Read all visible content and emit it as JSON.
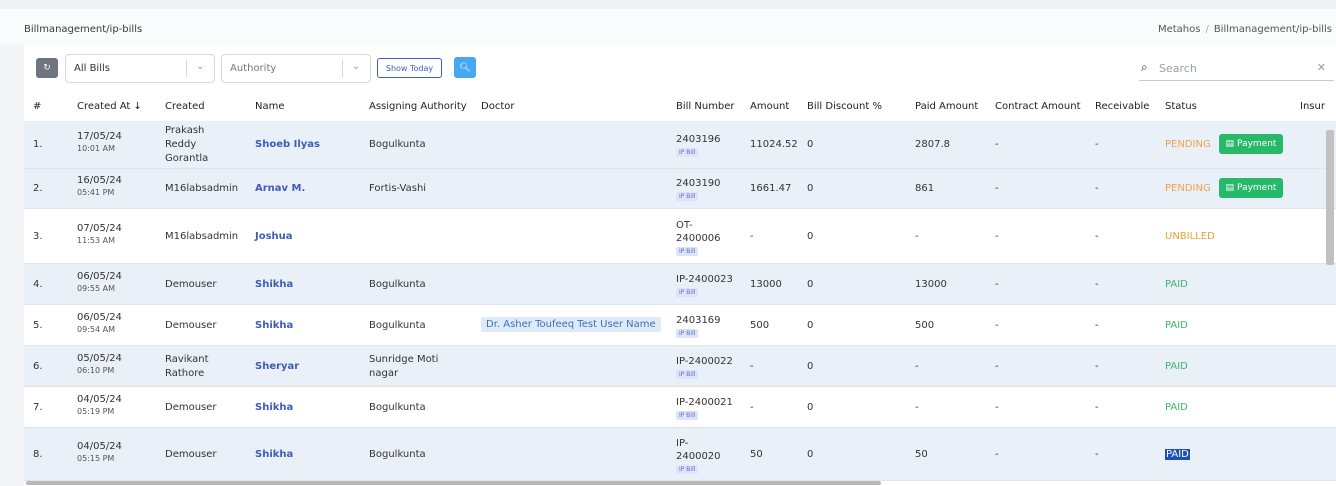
{
  "page_title": "Billmanagement/ip-bills",
  "breadcrumb": [
    "Metahos",
    "Billmanagement/ip-bills"
  ],
  "toolbar": {
    "refresh_icon": "refresh-icon",
    "bills_filter": "All Bills",
    "authority_placeholder": "Authority",
    "show_today": "Show Today",
    "search_button_icon": "search-icon",
    "search_placeholder": "Search"
  },
  "columns": [
    "#",
    "Created At",
    "Created",
    "Name",
    "Assigning Authority",
    "Doctor",
    "Bill Number",
    "Amount",
    "Bill Discount %",
    "Paid Amount",
    "Contract Amount",
    "Receivable",
    "Status",
    "Insur"
  ],
  "bill_badge": "IP Bill",
  "payment_label": "Payment",
  "rows": [
    {
      "num": "1.",
      "date": "17/05/24",
      "time": "10:01 AM",
      "created": [
        "Prakash",
        "Reddy",
        "Gorantla"
      ],
      "name": "Shoeb Ilyas",
      "authority": [
        "Bogulkunta"
      ],
      "doctor": "",
      "bill": [
        "2403196"
      ],
      "amount": "11024.52",
      "discount": "0",
      "paid": "2807.8",
      "contract": "-",
      "receivable": "-",
      "status": "PENDING"
    },
    {
      "num": "2.",
      "date": "16/05/24",
      "time": "05:41 PM",
      "created": [
        "M16labsadmin"
      ],
      "name": "Arnav M.",
      "authority": [
        "Fortis-Vashi"
      ],
      "doctor": "",
      "bill": [
        "2403190"
      ],
      "amount": "1661.47",
      "discount": "0",
      "paid": "861",
      "contract": "-",
      "receivable": "-",
      "status": "PENDING"
    },
    {
      "num": "3.",
      "date": "07/05/24",
      "time": "11:53 AM",
      "created": [
        "M16labsadmin"
      ],
      "name": "Joshua",
      "authority": [],
      "doctor": "",
      "bill": [
        "OT-",
        "2400006"
      ],
      "amount": "-",
      "discount": "0",
      "paid": "-",
      "contract": "-",
      "receivable": "-",
      "status": "UNBILLED"
    },
    {
      "num": "4.",
      "date": "06/05/24",
      "time": "09:55 AM",
      "created": [
        "Demouser"
      ],
      "name": "Shikha",
      "authority": [
        "Bogulkunta"
      ],
      "doctor": "",
      "bill": [
        "IP-2400023"
      ],
      "amount": "13000",
      "discount": "0",
      "paid": "13000",
      "contract": "-",
      "receivable": "-",
      "status": "PAID"
    },
    {
      "num": "5.",
      "date": "06/05/24",
      "time": "09:54 AM",
      "created": [
        "Demouser"
      ],
      "name": "Shikha",
      "authority": [
        "Bogulkunta"
      ],
      "doctor": "Dr. Asher Toufeeq Test User Name",
      "bill": [
        "2403169"
      ],
      "amount": "500",
      "discount": "0",
      "paid": "500",
      "contract": "-",
      "receivable": "-",
      "status": "PAID"
    },
    {
      "num": "6.",
      "date": "05/05/24",
      "time": "06:10 PM",
      "created": [
        "Ravikant",
        "Rathore"
      ],
      "name": "Sheryar",
      "authority": [
        "Sunridge Moti",
        "nagar"
      ],
      "doctor": "",
      "bill": [
        "IP-2400022"
      ],
      "amount": "-",
      "discount": "0",
      "paid": "-",
      "contract": "-",
      "receivable": "-",
      "status": "PAID"
    },
    {
      "num": "7.",
      "date": "04/05/24",
      "time": "05:19 PM",
      "created": [
        "Demouser"
      ],
      "name": "Shikha",
      "authority": [
        "Bogulkunta"
      ],
      "doctor": "",
      "bill": [
        "IP-2400021"
      ],
      "amount": "-",
      "discount": "0",
      "paid": "-",
      "contract": "-",
      "receivable": "-",
      "status": "PAID"
    },
    {
      "num": "8.",
      "date": "04/05/24",
      "time": "05:15 PM",
      "created": [
        "Demouser"
      ],
      "name": "Shikha",
      "authority": [
        "Bogulkunta"
      ],
      "doctor": "",
      "bill": [
        "IP-",
        "2400020"
      ],
      "amount": "50",
      "discount": "0",
      "paid": "50",
      "contract": "-",
      "receivable": "-",
      "status": "PAID"
    }
  ]
}
